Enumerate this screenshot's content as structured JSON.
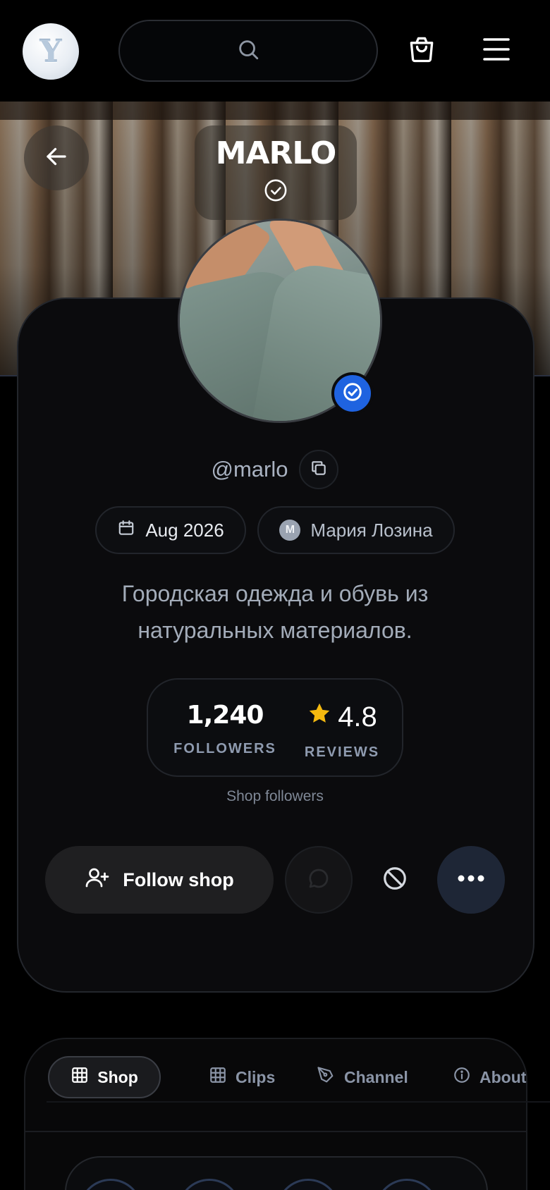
{
  "header": {
    "logo_letter": "Y",
    "search_icon": "search-icon",
    "cart_icon": "shopping-bag-icon",
    "menu_icon": "hamburger-menu-icon"
  },
  "banner": {
    "shop_name": "MARLO",
    "back_icon": "arrow-left-icon",
    "verified_icon": "check-circle-icon"
  },
  "profile": {
    "handle": "@marlo",
    "copy_icon": "copy-icon",
    "joined": "Aug 2026",
    "owner_initial": "M",
    "owner_name": "Мария Лозина",
    "description": "Городская одежда и обувь из натуральных материалов.",
    "stats": {
      "followers_value": "1,240",
      "followers_label": "FOLLOWERS",
      "rating_value": "4.8",
      "reviews_label": "REVIEWS",
      "caption": "Shop followers"
    },
    "actions": {
      "follow_label": "Follow shop"
    }
  },
  "tabs": [
    {
      "label": "Shop",
      "active": true
    },
    {
      "label": "Clips",
      "active": false
    },
    {
      "label": "Channel",
      "active": false
    },
    {
      "label": "About",
      "active": false
    }
  ],
  "colors": {
    "accent_blue": "#1f63e0",
    "star": "#f5b90f",
    "background": "#000000"
  }
}
